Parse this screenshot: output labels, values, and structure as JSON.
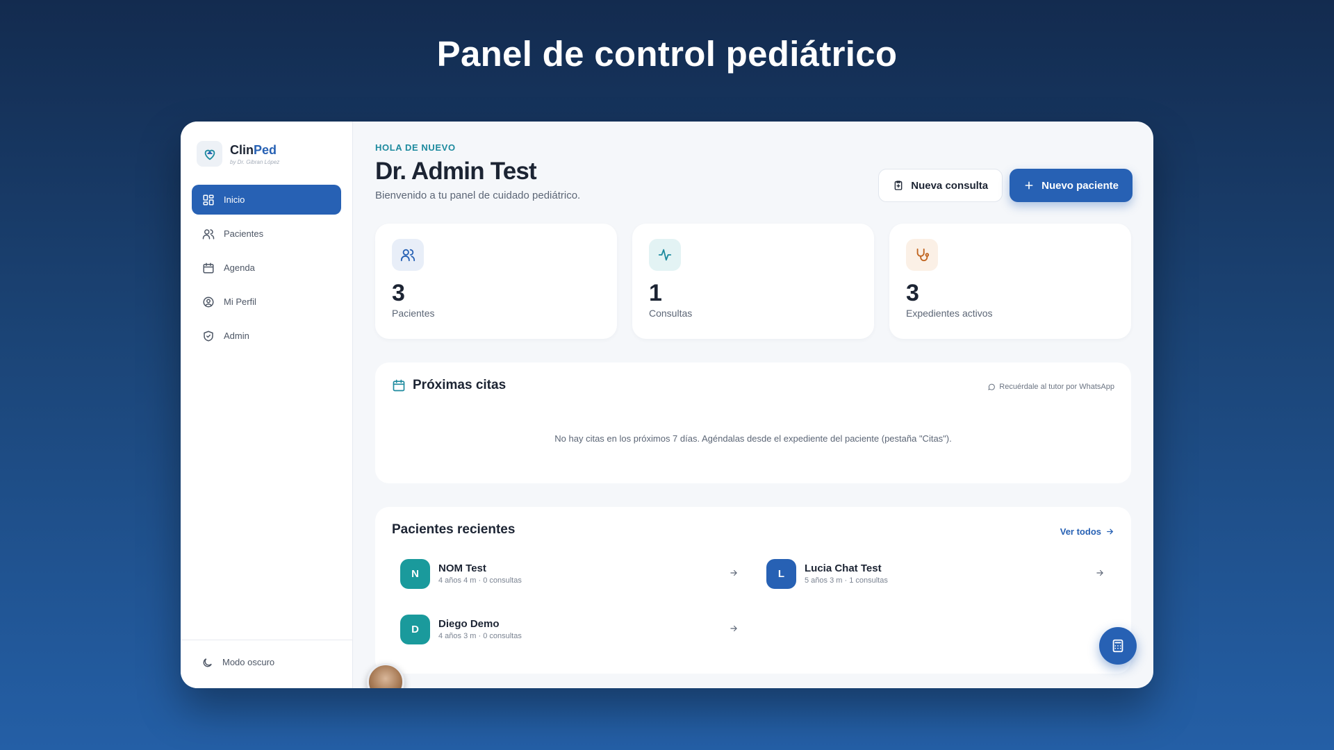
{
  "page": {
    "title": "Panel de control pediátrico"
  },
  "brand": {
    "name_main": "Clin",
    "name_accent": "Ped",
    "subtitle": "by Dr. Gibran López"
  },
  "sidebar": {
    "items": [
      {
        "label": "Inicio",
        "icon": "dashboard-icon",
        "active": true
      },
      {
        "label": "Pacientes",
        "icon": "users-icon"
      },
      {
        "label": "Agenda",
        "icon": "calendar-icon"
      },
      {
        "label": "Mi Perfil",
        "icon": "user-circle-icon"
      },
      {
        "label": "Admin",
        "icon": "shield-check-icon"
      }
    ],
    "dark_mode_label": "Modo oscuro"
  },
  "header": {
    "greeting": "HOLA DE NUEVO",
    "name": "Dr. Admin Test",
    "welcome": "Bienvenido a tu panel de cuidado pediátrico.",
    "new_consult_label": "Nueva consulta",
    "new_patient_label": "Nuevo paciente"
  },
  "stats": [
    {
      "value": "3",
      "label": "Pacientes",
      "icon": "users-icon",
      "color": "#2761b4"
    },
    {
      "value": "1",
      "label": "Consultas",
      "icon": "activity-icon",
      "color": "#1d8a9e"
    },
    {
      "value": "3",
      "label": "Expedientes activos",
      "icon": "stethoscope-icon",
      "color": "#c0641f"
    }
  ],
  "appointments": {
    "title": "Próximas citas",
    "whatsapp_hint": "Recuérdale al tutor por WhatsApp",
    "empty_message": "No hay citas en los próximos 7 días. Agéndalas desde el expediente del paciente (pestaña \"Citas\")."
  },
  "recent": {
    "title": "Pacientes recientes",
    "see_all": "Ver todos",
    "patients": [
      {
        "initial": "N",
        "name": "NOM Test",
        "meta": "4 años 4 m · 0 consultas",
        "color": "#1a9a9c"
      },
      {
        "initial": "L",
        "name": "Lucia Chat Test",
        "meta": "5 años 3 m · 1 consultas",
        "color": "#2761b4"
      },
      {
        "initial": "D",
        "name": "Diego Demo",
        "meta": "4 años 3 m · 0 consultas",
        "color": "#1a9a9c"
      }
    ]
  },
  "colors": {
    "primary": "#2761b4",
    "teal": "#1d8a9e",
    "orange": "#c0641f"
  }
}
